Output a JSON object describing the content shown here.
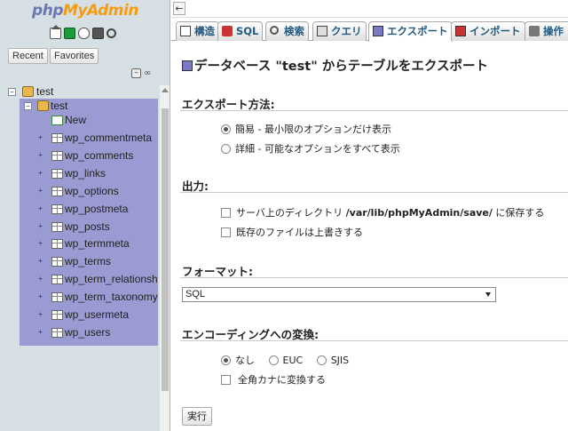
{
  "app": {
    "logo_php": "php",
    "logo_myadmin": "MyAdmin"
  },
  "nav": {
    "icons": [
      "home-icon",
      "sql-query-icon",
      "docs-icon",
      "help-icon",
      "reload-icon"
    ],
    "recent_label": "Recent",
    "favorites_label": "Favorites",
    "collapse_symbol": "–",
    "link_symbol": "∞",
    "server_db": "test",
    "selected_db": "test",
    "new_label": "New",
    "tables": [
      "wp_commentmeta",
      "wp_comments",
      "wp_links",
      "wp_options",
      "wp_postmeta",
      "wp_posts",
      "wp_termmeta",
      "wp_terms",
      "wp_term_relationships",
      "wp_term_taxonomy",
      "wp_usermeta",
      "wp_users"
    ],
    "highlight_color": "#9b9bd3"
  },
  "tabs": [
    {
      "label": "構造",
      "icon": "structure-icon"
    },
    {
      "label": "SQL",
      "icon": "sql-icon"
    },
    {
      "label": "検索",
      "icon": "search-icon"
    },
    {
      "label": "クエリ",
      "icon": "query-icon"
    },
    {
      "label": "エクスポート",
      "icon": "export-icon",
      "active": true
    },
    {
      "label": "インポート",
      "icon": "import-icon"
    },
    {
      "label": "操作",
      "icon": "operations-icon"
    }
  ],
  "page": {
    "title": "データベース \"test\" からテーブルをエクスポート",
    "export_method": {
      "heading": "エクスポート方法:",
      "quick": "簡易 - 最小限のオプションだけ表示",
      "custom": "詳細 - 可能なオプションをすべて表示",
      "selected": "quick"
    },
    "output": {
      "heading": "出力:",
      "save_prefix": "サーバ上のディレクトリ",
      "save_path": "/var/lib/phpMyAdmin/save/",
      "save_suffix": "に保存する",
      "overwrite": "既存のファイルは上書きする"
    },
    "format": {
      "heading": "フォーマット:",
      "selected": "SQL"
    },
    "encoding": {
      "heading": "エンコーディングへの変換:",
      "options": [
        "なし",
        "EUC",
        "SJIS"
      ],
      "selected": "なし",
      "kana": "全角カナに変換する"
    },
    "run_label": "実行"
  }
}
